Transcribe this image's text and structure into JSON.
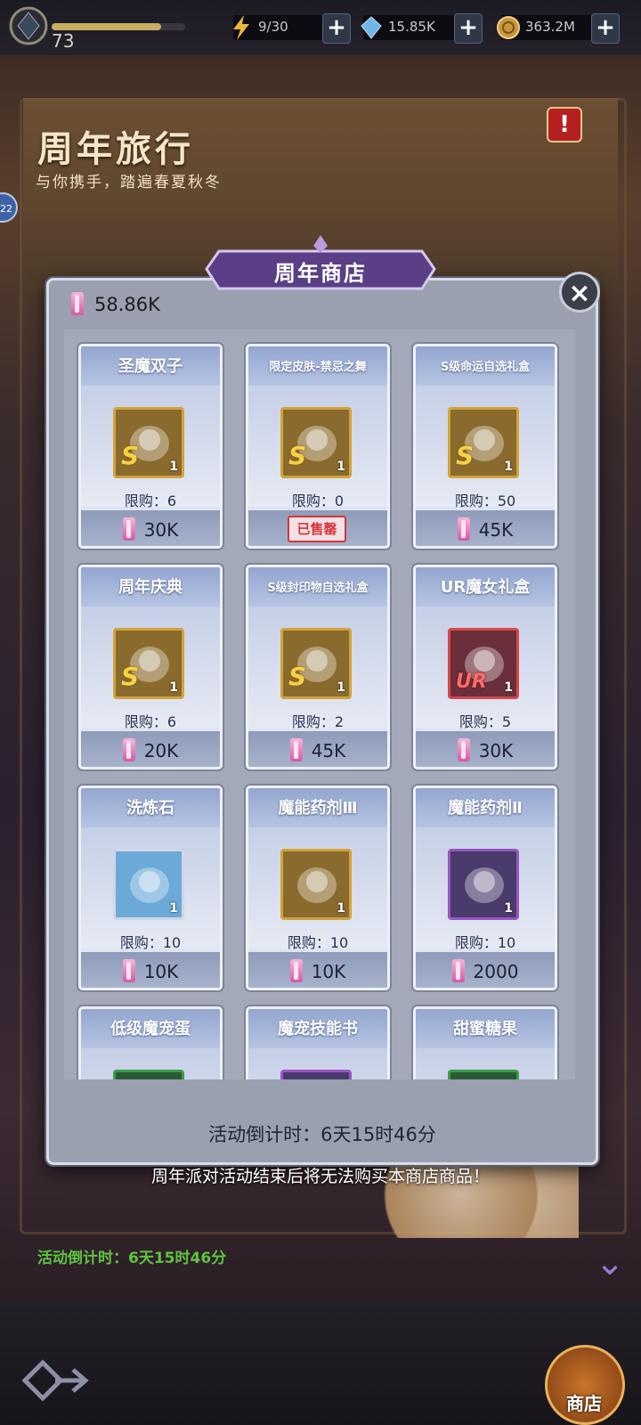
{
  "topbar": {
    "level": "73",
    "xp_progress": 0.82,
    "energy": "9/30",
    "gems": "15.85K",
    "gold": "363.2M",
    "plus": "+"
  },
  "event": {
    "title": "周年旅行",
    "subtitle": "与你携手，踏遍春夏秋冬",
    "alert": "!",
    "side_badge": "22",
    "bg_countdown": "活动倒计时：6天15时46分"
  },
  "shop": {
    "title": "周年商店",
    "balance": "58.86K",
    "close": "×",
    "countdown": "活动倒计时：6天15时46分",
    "notice": "周年派对活动结束后将无法购买本商店商品！",
    "items": [
      {
        "name": "圣魔双子",
        "rank": "S",
        "count": "1",
        "limit": "限购：6",
        "price": "30K",
        "frame": "gold",
        "icon": "twins-art"
      },
      {
        "name": "限定皮肤-禁忌之舞",
        "rank": "S",
        "count": "1",
        "limit": "限购：0",
        "price": "",
        "soldout": "已售罄",
        "frame": "gold",
        "icon": "skin-art"
      },
      {
        "name": "S级命运自选礼盒",
        "rank": "S",
        "count": "1",
        "limit": "限购：50",
        "price": "45K",
        "frame": "gold",
        "icon": "chest-icon"
      },
      {
        "name": "周年庆典",
        "rank": "S",
        "count": "1",
        "limit": "限购：6",
        "price": "20K",
        "frame": "gold",
        "icon": "cards-art"
      },
      {
        "name": "S级封印物自选礼盒",
        "rank": "S",
        "count": "1",
        "limit": "限购：2",
        "price": "45K",
        "frame": "gold",
        "icon": "chest-icon"
      },
      {
        "name": "UR魔女礼盒",
        "rank": "UR",
        "count": "1",
        "limit": "限购：5",
        "price": "30K",
        "frame": "red",
        "icon": "gift-icon"
      },
      {
        "name": "洗炼石",
        "rank": "",
        "count": "1",
        "limit": "限购：10",
        "price": "10K",
        "frame": "blue",
        "icon": "stone-icon"
      },
      {
        "name": "魔能药剂Ⅲ",
        "rank": "",
        "count": "1",
        "limit": "限购：10",
        "price": "10K",
        "frame": "gold",
        "icon": "potion-icon"
      },
      {
        "name": "魔能药剂Ⅱ",
        "rank": "",
        "count": "1",
        "limit": "限购：10",
        "price": "2000",
        "frame": "purple",
        "icon": "potion-icon"
      },
      {
        "name": "低级魔宠蛋",
        "rank": "",
        "count": "",
        "limit": "",
        "price": "",
        "frame": "green",
        "icon": "egg-icon"
      },
      {
        "name": "魔宠技能书",
        "rank": "",
        "count": "",
        "limit": "",
        "price": "",
        "frame": "purple",
        "icon": "book-icon"
      },
      {
        "name": "甜蜜糖果",
        "rank": "",
        "count": "",
        "limit": "",
        "price": "",
        "frame": "green",
        "icon": "candy-icon"
      }
    ]
  },
  "nav": {
    "shop_label": "商店"
  }
}
